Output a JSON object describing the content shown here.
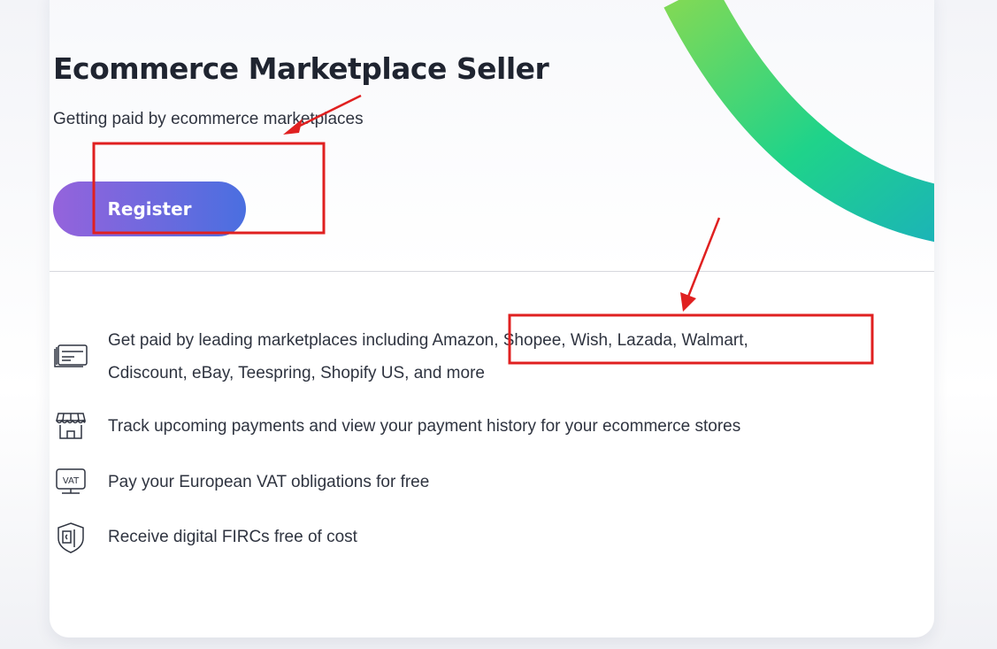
{
  "card": {
    "title": "Ecommerce Marketplace Seller",
    "subtitle": "Getting paid by ecommerce marketplaces",
    "register_label": "Register"
  },
  "features": [
    {
      "icon": "payment-cards-icon",
      "text": "Get paid by leading marketplaces including Amazon, Shopee, Wish, Lazada, Walmart, Cdiscount, eBay, Teespring, Shopify US, and more"
    },
    {
      "icon": "storefront-icon",
      "text": "Track upcoming payments and view your payment history for your ecommerce stores"
    },
    {
      "icon": "vat-monitor-icon",
      "text": "Pay your European VAT obligations for free"
    },
    {
      "icon": "shield-document-icon",
      "text": "Receive digital FIRCs free of cost"
    }
  ],
  "colors": {
    "button_start": "#9563dc",
    "button_end": "#4a6fe0",
    "arc_start": "#7ed957",
    "arc_mid": "#1fd38a",
    "arc_end": "#1bb3b8",
    "annotation": "#e02020"
  }
}
